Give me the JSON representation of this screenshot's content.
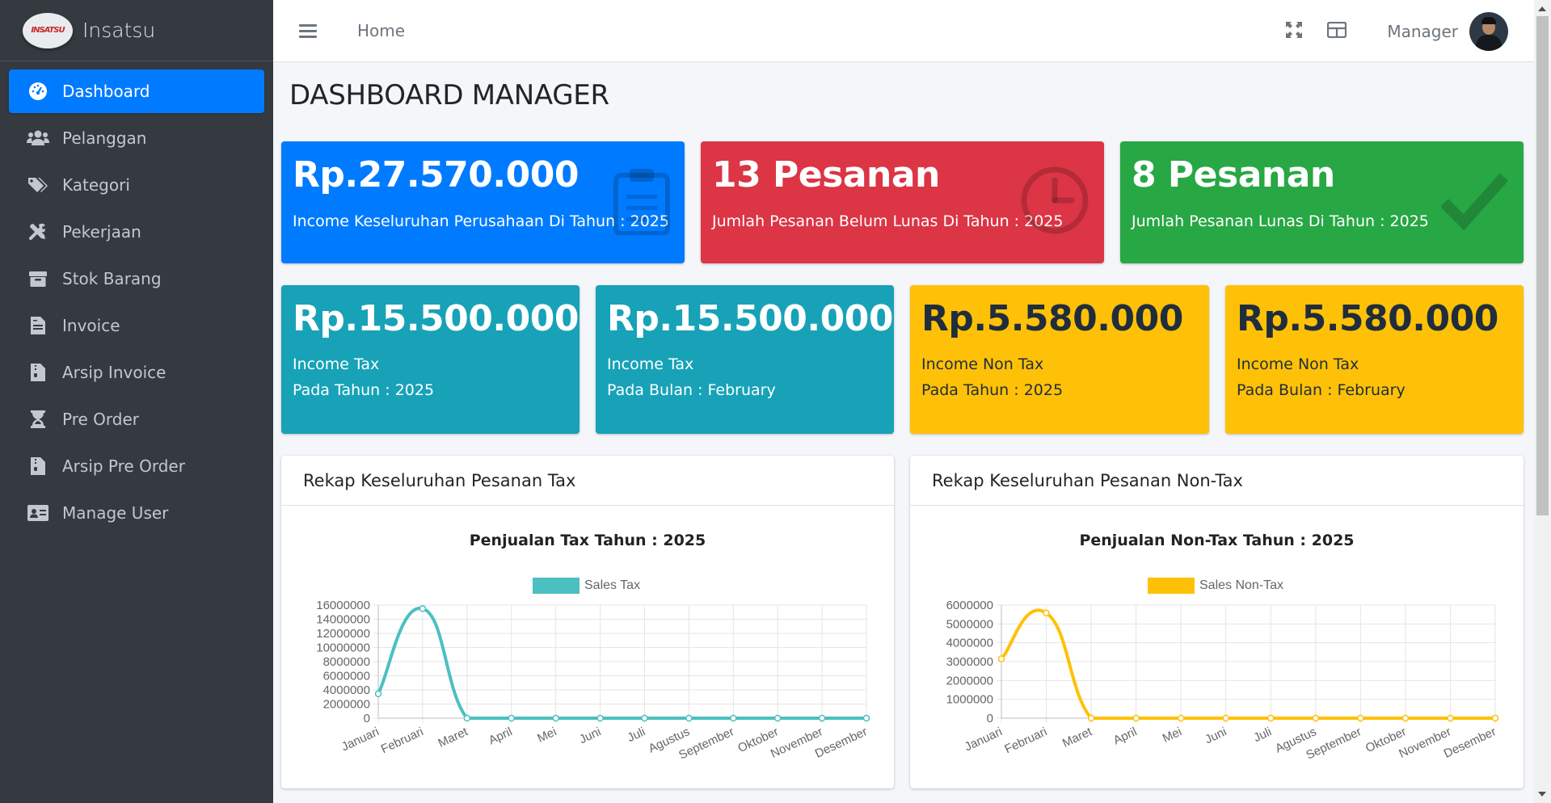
{
  "app": {
    "brand": "Insatsu",
    "logo_text": "INSATSU"
  },
  "sidebar": {
    "items": [
      {
        "label": "Dashboard",
        "icon": "tachometer-icon"
      },
      {
        "label": "Pelanggan",
        "icon": "users-icon"
      },
      {
        "label": "Kategori",
        "icon": "tags-icon"
      },
      {
        "label": "Pekerjaan",
        "icon": "tools-icon"
      },
      {
        "label": "Stok Barang",
        "icon": "archive-icon"
      },
      {
        "label": "Invoice",
        "icon": "file-invoice-icon"
      },
      {
        "label": "Arsip Invoice",
        "icon": "file-archive-icon"
      },
      {
        "label": "Pre Order",
        "icon": "hourglass-icon"
      },
      {
        "label": "Arsip Pre Order",
        "icon": "file-archive-icon"
      },
      {
        "label": "Manage User",
        "icon": "id-card-icon"
      }
    ],
    "active_index": 0
  },
  "navbar": {
    "home": "Home",
    "user": "Manager"
  },
  "page": {
    "title": "DASHBOARD MANAGER"
  },
  "stats_row1": [
    {
      "value": "Rp.27.570.000",
      "label": "Income Keseluruhan Perusahaan Di Tahun : 2025",
      "color": "#007bff",
      "icon": "clipboard-icon"
    },
    {
      "value": "13 Pesanan",
      "label": "Jumlah Pesanan Belum Lunas Di Tahun : 2025",
      "color": "#dc3545",
      "icon": "clock-icon"
    },
    {
      "value": "8 Pesanan",
      "label": "Jumlah Pesanan Lunas Di Tahun : 2025",
      "color": "#28a745",
      "icon": "check-icon"
    }
  ],
  "stats_row2": [
    {
      "value": "Rp.15.500.000",
      "label1": "Income Tax",
      "label2": "Pada Tahun : 2025",
      "color": "#17a2b8"
    },
    {
      "value": "Rp.15.500.000",
      "label1": "Income Tax",
      "label2": "Pada Bulan : February",
      "color": "#17a2b8"
    },
    {
      "value": "Rp.5.580.000",
      "label1": "Income Non Tax",
      "label2": "Pada Tahun : 2025",
      "color": "#ffc107"
    },
    {
      "value": "Rp.5.580.000",
      "label1": "Income Non Tax",
      "label2": "Pada Bulan : February",
      "color": "#ffc107"
    }
  ],
  "cards": {
    "tax_header": "Rekap Keseluruhan Pesanan Tax",
    "nontax_header": "Rekap Keseluruhan Pesanan Non-Tax"
  },
  "chart_data": [
    {
      "type": "line",
      "title": "Penjualan Tax Tahun : 2025",
      "categories": [
        "Januari",
        "Februari",
        "Maret",
        "April",
        "Mei",
        "Juni",
        "Juli",
        "Agustus",
        "September",
        "Oktober",
        "November",
        "Desember"
      ],
      "series": [
        {
          "name": "Sales Tax",
          "values": [
            3450000,
            15500000,
            0,
            0,
            0,
            0,
            0,
            0,
            0,
            0,
            0,
            0
          ],
          "color": "#4bc0c0"
        }
      ],
      "yticks": [
        0,
        2000000,
        4000000,
        6000000,
        8000000,
        10000000,
        12000000,
        14000000,
        16000000
      ],
      "ylim": [
        0,
        16000000
      ],
      "grid": true,
      "legend": "top"
    },
    {
      "type": "line",
      "title": "Penjualan Non-Tax Tahun : 2025",
      "categories": [
        "Januari",
        "Februari",
        "Maret",
        "April",
        "Mei",
        "Juni",
        "Juli",
        "Agustus",
        "September",
        "Oktober",
        "November",
        "Desember"
      ],
      "series": [
        {
          "name": "Sales Non-Tax",
          "values": [
            3150000,
            5580000,
            0,
            0,
            0,
            0,
            0,
            0,
            0,
            0,
            0,
            0
          ],
          "color": "#ffc107"
        }
      ],
      "yticks": [
        0,
        1000000,
        2000000,
        3000000,
        4000000,
        5000000,
        6000000
      ],
      "ylim": [
        0,
        6000000
      ],
      "grid": true,
      "legend": "top"
    }
  ]
}
